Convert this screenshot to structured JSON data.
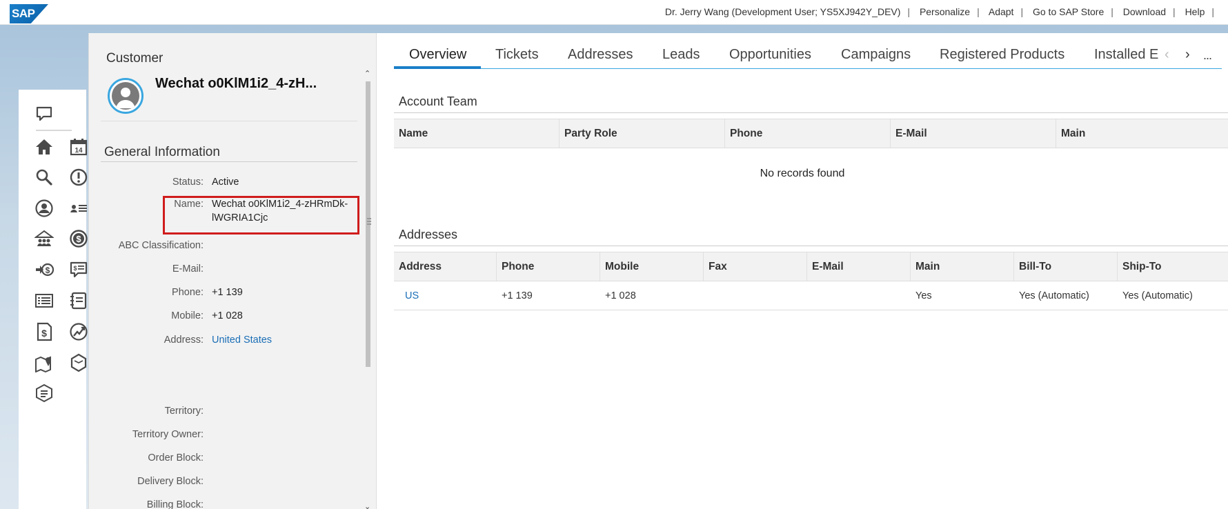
{
  "header": {
    "logo": "SAP",
    "links": [
      "Dr. Jerry Wang (Development User; YS5XJ942Y_DEV)",
      "Personalize",
      "Adapt",
      "Go to SAP Store",
      "Download",
      "Help"
    ]
  },
  "nav": {
    "icons": [
      "chat-icon",
      "home-icon",
      "calendar-icon",
      "search-icon",
      "alert-icon",
      "account-icon",
      "contacts-icon",
      "company-icon",
      "sales-icon",
      "revenue-icon",
      "quote-icon",
      "list-icon",
      "notebook-icon",
      "invoice-icon",
      "forecast-icon",
      "map-icon",
      "products-icon",
      "documents-icon"
    ],
    "calendar_day": "14"
  },
  "customer": {
    "type": "Customer",
    "name_short": "Wechat o0KlM1i2_4-zH...",
    "section": "General Information",
    "fields": [
      {
        "label": "Status:",
        "value": "Active"
      },
      {
        "label": "Name:",
        "value": "Wechat o0KlM1i2_4-zHRmDk-",
        "value2": "lWGRIA1Cjc"
      },
      {
        "label": "ABC Classification:",
        "value": ""
      },
      {
        "label": "E-Mail:",
        "value": ""
      },
      {
        "label": "Phone:",
        "value": "+1 139"
      },
      {
        "label": "Mobile:",
        "value": "+1 028"
      },
      {
        "label": "Address:",
        "value": "United States"
      },
      {
        "label": "Territory:",
        "value": ""
      },
      {
        "label": "Territory Owner:",
        "value": ""
      },
      {
        "label": "Order Block:",
        "value": ""
      },
      {
        "label": "Delivery Block:",
        "value": ""
      },
      {
        "label": "Billing Block:",
        "value": ""
      }
    ]
  },
  "tabs": [
    "Overview",
    "Tickets",
    "Addresses",
    "Leads",
    "Opportunities",
    "Campaigns",
    "Registered Products",
    "Installed E"
  ],
  "more_label": "...",
  "account_team": {
    "title": "Account Team",
    "columns": [
      "Name",
      "Party Role",
      "Phone",
      "E-Mail",
      "Main"
    ],
    "empty_text": "No records found"
  },
  "addresses": {
    "title": "Addresses",
    "columns": [
      "Address",
      "Phone",
      "Mobile",
      "Fax",
      "E-Mail",
      "Main",
      "Bill-To",
      "Ship-To"
    ],
    "rows": [
      [
        "US",
        "+1 139",
        "+1 028",
        "",
        "",
        "Yes",
        "Yes (Automatic)",
        "Yes (Automatic)"
      ]
    ]
  },
  "colors": {
    "accent": "#1a7fc9",
    "link": "#1a6eb6",
    "highlight": "#d01c1c",
    "avatar_ring": "#3aa7e0"
  }
}
